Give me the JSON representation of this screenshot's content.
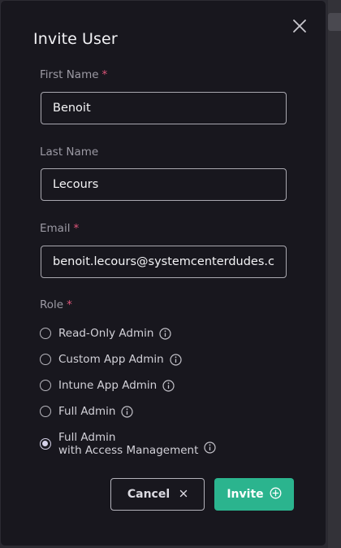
{
  "dialog": {
    "title": "Invite User",
    "close_icon": "close-icon"
  },
  "form": {
    "first_name": {
      "label": "First Name",
      "required_mark": "*",
      "value": "Benoit"
    },
    "last_name": {
      "label": "Last Name",
      "value": "Lecours"
    },
    "email": {
      "label": "Email",
      "required_mark": "*",
      "value": "benoit.lecours@systemcenterdudes.co"
    },
    "role": {
      "label": "Role",
      "required_mark": "*",
      "options": [
        {
          "label": "Read-Only Admin",
          "checked": false,
          "icon": "info-icon"
        },
        {
          "label": "Custom App Admin",
          "checked": false,
          "icon": "info-icon"
        },
        {
          "label": "Intune App Admin",
          "checked": false,
          "icon": "info-icon"
        },
        {
          "label": "Full Admin",
          "checked": false,
          "icon": "info-icon"
        },
        {
          "label_line1": "Full Admin",
          "label_line2": "with Access Management",
          "checked": true,
          "icon": "info-icon"
        }
      ]
    }
  },
  "actions": {
    "cancel_label": "Cancel",
    "cancel_icon": "close-icon",
    "invite_label": "Invite",
    "invite_icon": "plus-circle-icon"
  },
  "colors": {
    "modal_bg": "#18171e",
    "accent": "#2bb48e",
    "required": "#e0557a"
  }
}
